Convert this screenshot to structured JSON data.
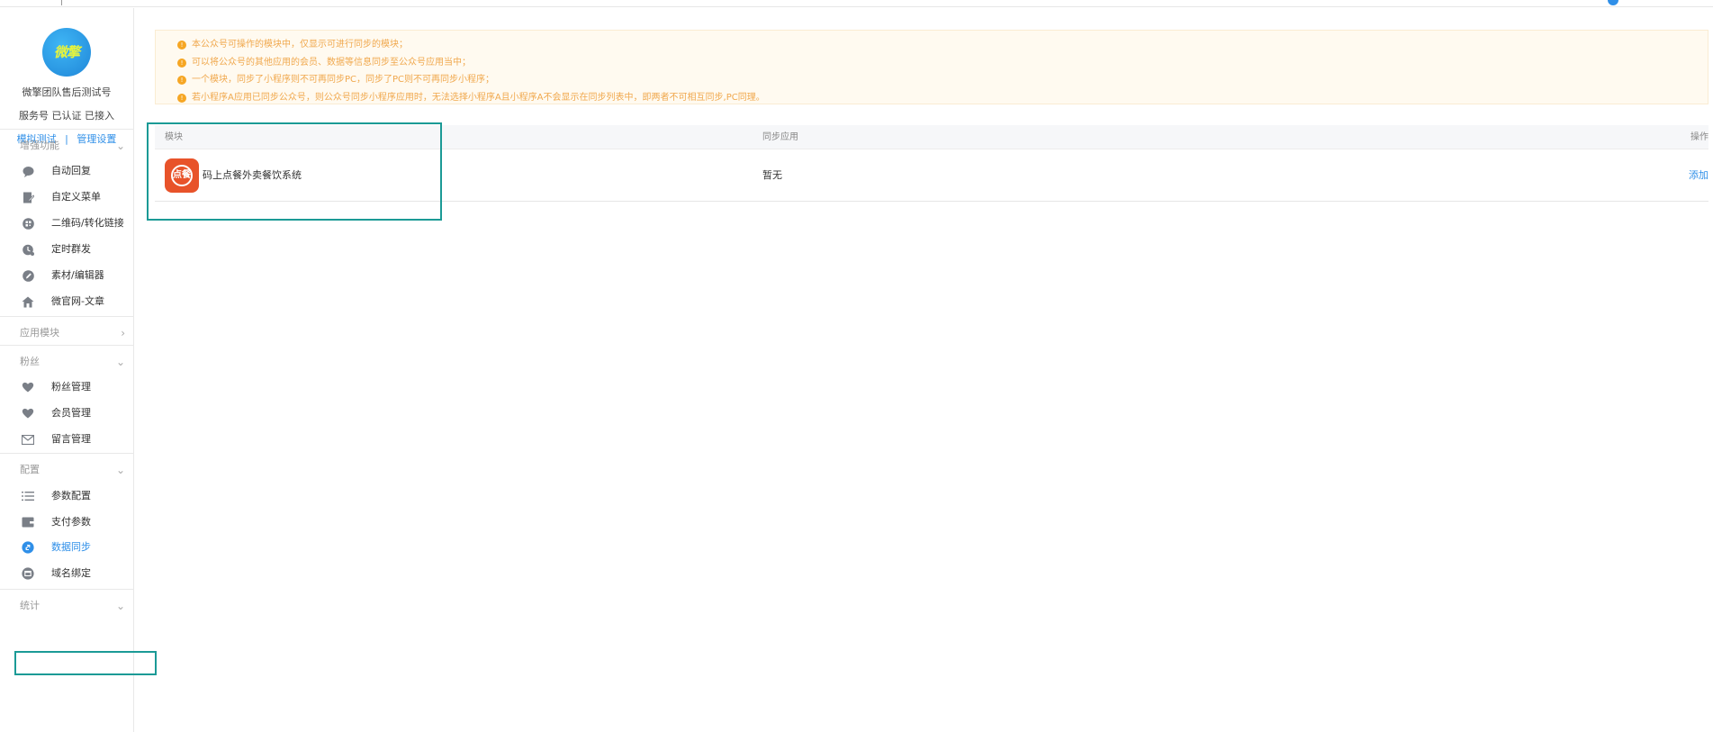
{
  "colors": {
    "accent": "#2f8fe8",
    "highlight": "#1b9a96",
    "notice_text": "#f0a84d",
    "notice_bg": "#fffaf0",
    "app_icon": "#e8532a"
  },
  "account": {
    "logo_text": "微擎",
    "name": "微擎团队售后测试号",
    "status": "服务号 已认证 已接入",
    "links": [
      {
        "label": "模拟测试"
      },
      {
        "label": "管理设置"
      }
    ],
    "separator": "|"
  },
  "sidebar": {
    "sections": [
      {
        "title": "增强功能",
        "chevron": "chevron-down-icon",
        "items": [
          {
            "label": "自动回复",
            "icon": "chat-bubble-icon"
          },
          {
            "label": "自定义菜单",
            "icon": "edit-menu-icon"
          },
          {
            "label": "二维码/转化链接",
            "icon": "qrcode-icon"
          },
          {
            "label": "定时群发",
            "icon": "clock-send-icon"
          },
          {
            "label": "素材/编辑器",
            "icon": "pencil-icon"
          },
          {
            "label": "微官网-文章",
            "icon": "home-icon"
          }
        ]
      },
      {
        "title": "应用模块",
        "chevron": "chevron-right-icon",
        "items": []
      },
      {
        "title": "粉丝",
        "chevron": "chevron-down-icon",
        "items": [
          {
            "label": "粉丝管理",
            "icon": "heart-icon"
          },
          {
            "label": "会员管理",
            "icon": "heart-icon"
          },
          {
            "label": "留言管理",
            "icon": "mail-icon"
          }
        ]
      },
      {
        "title": "配置",
        "chevron": "chevron-down-icon",
        "items": [
          {
            "label": "参数配置",
            "icon": "list-icon"
          },
          {
            "label": "支付参数",
            "icon": "wallet-icon"
          },
          {
            "label": "数据同步",
            "icon": "sync-icon",
            "active": true
          },
          {
            "label": "域名绑定",
            "icon": "domain-icon"
          }
        ]
      },
      {
        "title": "统计",
        "chevron": "chevron-down-icon",
        "items": []
      }
    ]
  },
  "notice": {
    "lines": [
      "本公众号可操作的模块中，仅显示可进行同步的模块；",
      "可以将公众号的其他应用的会员、数据等信息同步至公众号应用当中；",
      "一个模块，同步了小程序则不可再同步PC，同步了PC则不可再同步小程序；",
      "若小程序A应用已同步公众号，则公众号同步小程序应用时，无法选择小程序A且小程序A不会显示在同步列表中，即两者不可相互同步,PC同理。"
    ]
  },
  "table": {
    "columns": [
      "模块",
      "同步应用",
      "操作"
    ],
    "rows": [
      {
        "module_icon_text": "点餐",
        "module": "码上点餐外卖餐饮系统",
        "sync_app": "暂无",
        "action": "添加"
      }
    ]
  }
}
